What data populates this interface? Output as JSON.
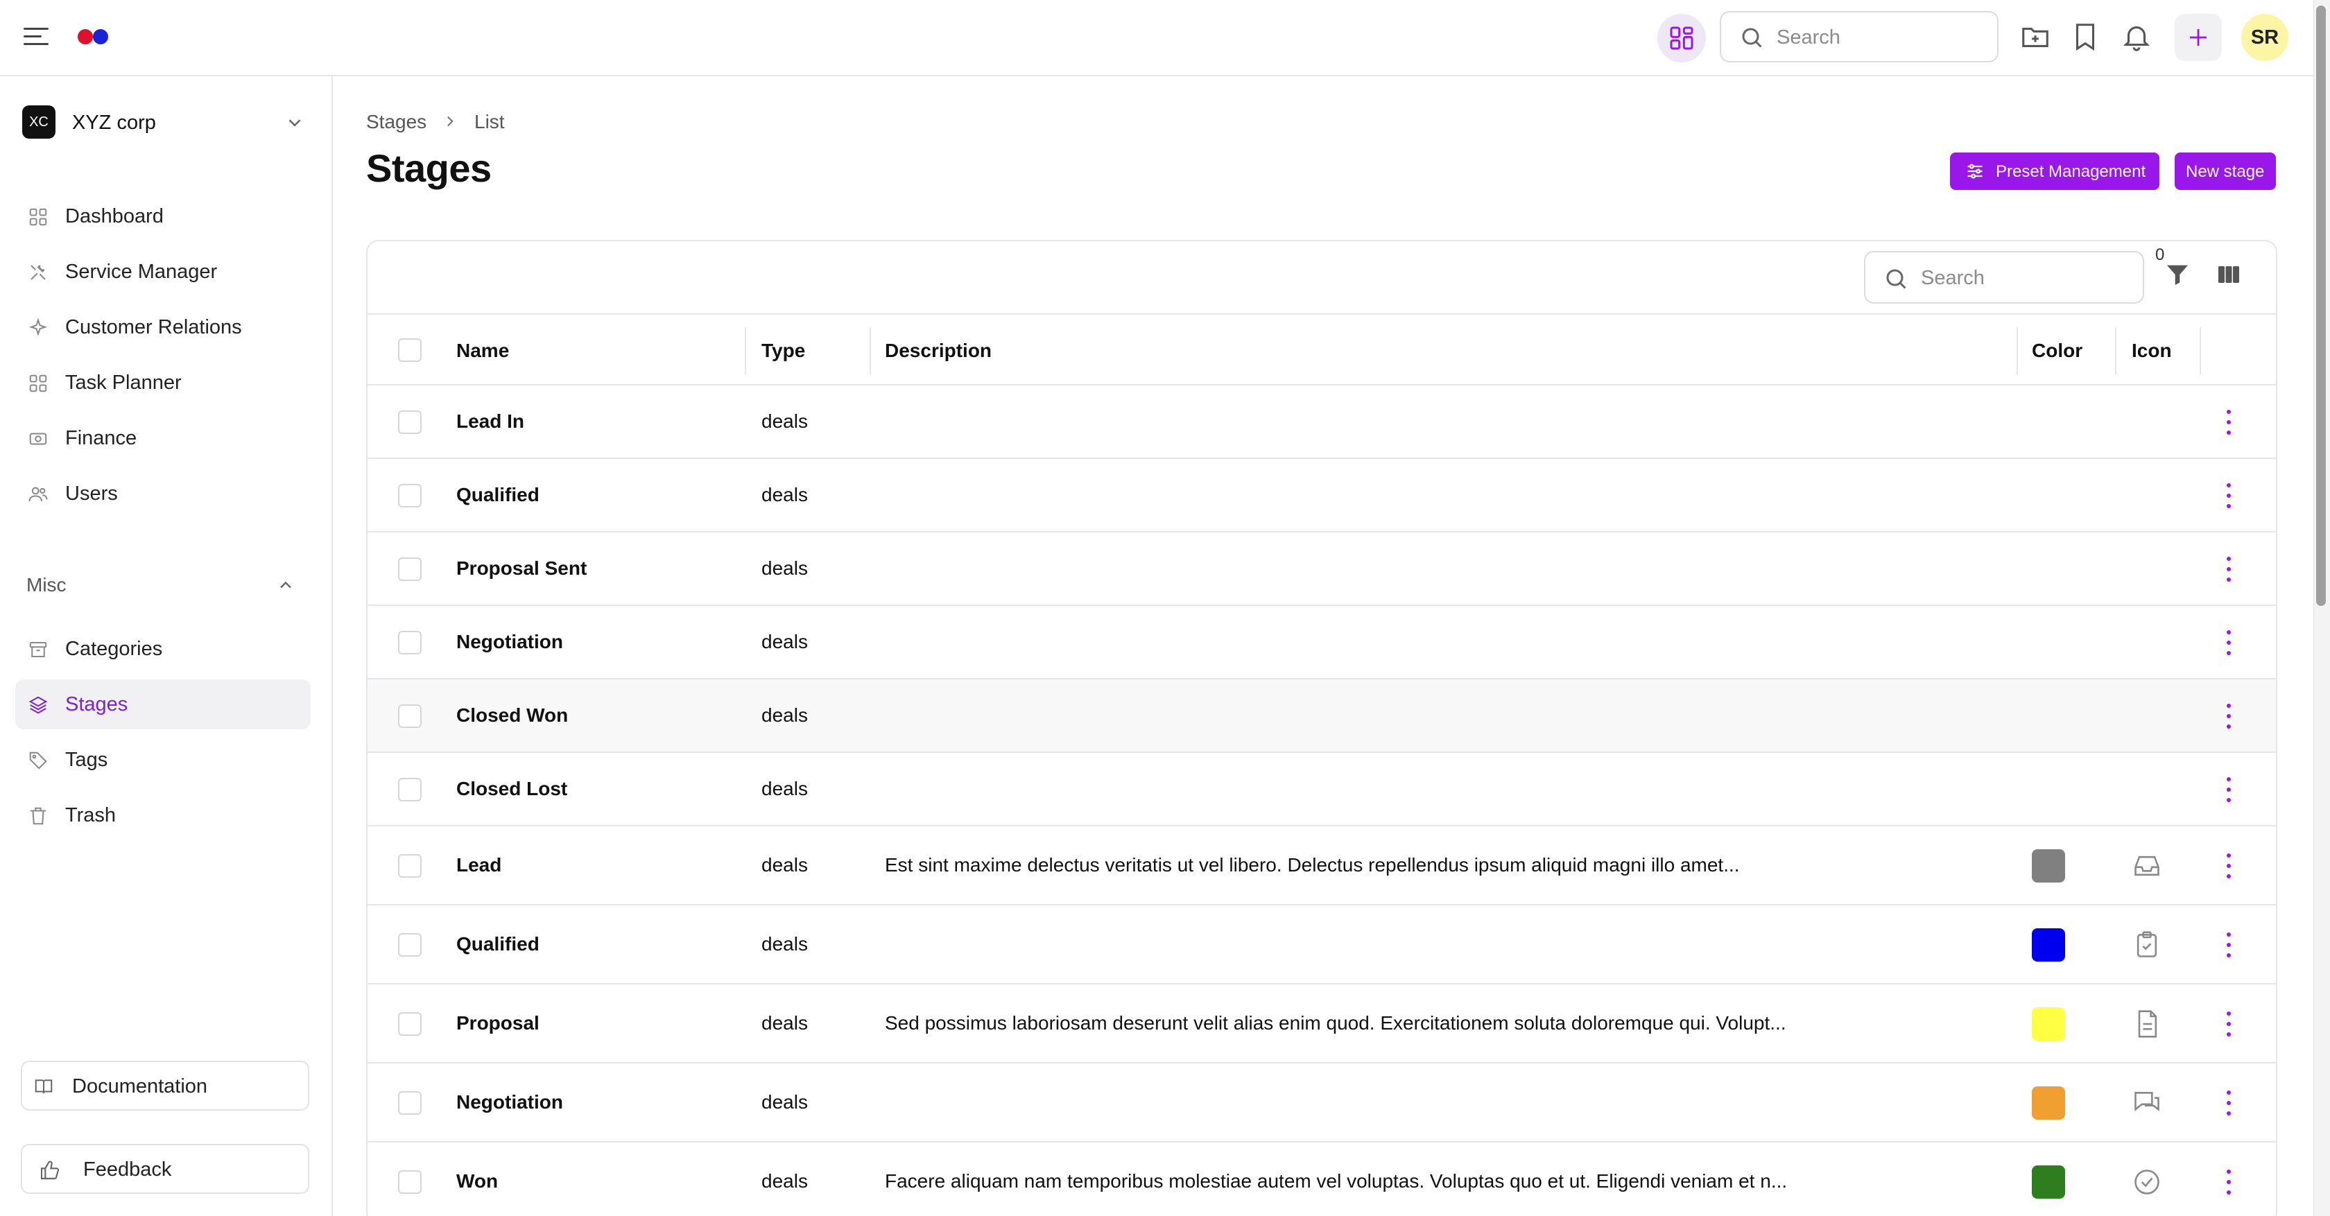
{
  "header": {
    "search_placeholder": "Search",
    "avatar_initials": "SR",
    "logo_colors": [
      "#e0122b",
      "#1a24d6"
    ],
    "accent": "#9a17ea"
  },
  "sidebar": {
    "org_badge": "XC",
    "org_name": "XYZ corp",
    "items": [
      {
        "label": "Dashboard",
        "icon": "grid-icon"
      },
      {
        "label": "Service Manager",
        "icon": "tools-icon"
      },
      {
        "label": "Customer Relations",
        "icon": "sparkle-icon"
      },
      {
        "label": "Task Planner",
        "icon": "grid-icon"
      },
      {
        "label": "Finance",
        "icon": "money-icon"
      },
      {
        "label": "Users",
        "icon": "users-icon"
      }
    ],
    "misc_label": "Misc",
    "misc_items": [
      {
        "label": "Categories",
        "icon": "archive-icon"
      },
      {
        "label": "Stages",
        "icon": "layers-icon",
        "active": true
      },
      {
        "label": "Tags",
        "icon": "tag-icon"
      },
      {
        "label": "Trash",
        "icon": "trash-icon"
      }
    ],
    "documentation_label": "Documentation",
    "feedback_label": "Feedback"
  },
  "main": {
    "breadcrumb": [
      "Stages",
      "List"
    ],
    "title": "Stages",
    "preset_button": "Preset Management",
    "new_button": "New stage",
    "table_search_placeholder": "Search",
    "filter_count": "0",
    "columns": [
      "Name",
      "Type",
      "Description",
      "Color",
      "Icon"
    ],
    "rows": [
      {
        "name": "Lead In",
        "type": "deals",
        "description": "",
        "color": "",
        "icon": ""
      },
      {
        "name": "Qualified",
        "type": "deals",
        "description": "",
        "color": "",
        "icon": ""
      },
      {
        "name": "Proposal Sent",
        "type": "deals",
        "description": "",
        "color": "",
        "icon": ""
      },
      {
        "name": "Negotiation",
        "type": "deals",
        "description": "",
        "color": "",
        "icon": ""
      },
      {
        "name": "Closed Won",
        "type": "deals",
        "description": "",
        "color": "",
        "icon": ""
      },
      {
        "name": "Closed Lost",
        "type": "deals",
        "description": "",
        "color": "",
        "icon": ""
      },
      {
        "name": "Lead",
        "type": "deals",
        "description": "Est sint maxime delectus veritatis ut vel libero. Delectus repellendus ipsum aliquid magni illo amet...",
        "color": "#808080",
        "icon": "inbox-icon"
      },
      {
        "name": "Qualified",
        "type": "deals",
        "description": "",
        "color": "#0000ee",
        "icon": "clipboard-check-icon"
      },
      {
        "name": "Proposal",
        "type": "deals",
        "description": "Sed possimus laboriosam deserunt velit alias enim quod. Exercitationem soluta doloremque qui. Volupt...",
        "color": "#ffff44",
        "icon": "document-icon"
      },
      {
        "name": "Negotiation",
        "type": "deals",
        "description": "",
        "color": "#f0a030",
        "icon": "chat-icon"
      },
      {
        "name": "Won",
        "type": "deals",
        "description": "Facere aliquam nam temporibus molestiae autem vel voluptas. Voluptas quo et ut. Eligendi veniam et n...",
        "color": "#2e7d1e",
        "icon": "check-circle-icon"
      }
    ]
  }
}
